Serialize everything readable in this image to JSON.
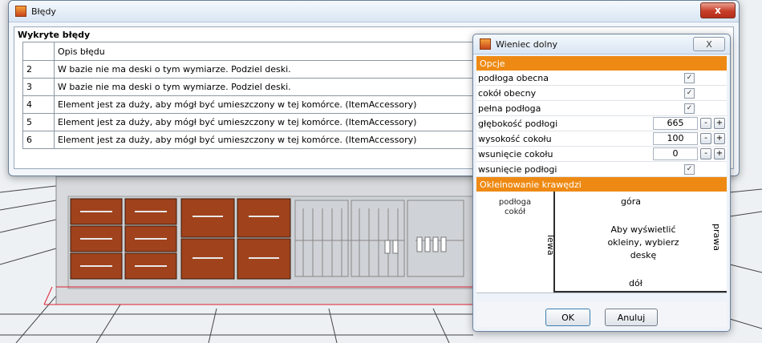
{
  "errors_window": {
    "title": "Błędy",
    "close_glyph": "x",
    "group_header": "Wykryte błędy",
    "table_header": "Opis błędu",
    "rows": [
      {
        "num": "2",
        "desc": "W bazie nie ma deski o tym wymiarze. Podziel deski."
      },
      {
        "num": "3",
        "desc": "W bazie nie ma deski o tym wymiarze. Podziel deski."
      },
      {
        "num": "4",
        "desc": "Element jest za duży, aby mógł być umieszczony w tej komórce. (ItemAccessory)"
      },
      {
        "num": "5",
        "desc": "Element jest za duży, aby mógł być umieszczony w tej komórce. (ItemAccessory)"
      },
      {
        "num": "6",
        "desc": "Element jest za duży, aby mógł być umieszczony w tej komórce. (ItemAccessory)"
      }
    ]
  },
  "wieniec_window": {
    "title": "Wieniec dolny",
    "close_glyph": "X",
    "options_header": "Opcje",
    "props": {
      "podloga_obecna": "podłoga obecna",
      "cokol_obecny": "cokół obecny",
      "pelna_podloga": "pełna podłoga",
      "glebokosc": "głębokość podłogi",
      "glebokosc_value": "665",
      "wysokosc": "wysokość cokołu",
      "wysokosc_value": "100",
      "wsuniecie_cokolu": "wsunięcie cokołu",
      "wsuniecie_cokolu_value": "0",
      "wsuniecie_podlogi": "wsunięcie podłogi",
      "check_glyph": "✓",
      "minus": "-",
      "plus": "+"
    },
    "edges_header": "Okleinowanie krawędzi",
    "edges": {
      "list_1": "podłoga",
      "list_2": "cokół",
      "top": "góra",
      "bottom": "dół",
      "left": "lewa",
      "right": "prawa",
      "hint": "Aby wyświetlić okleiny, wybierz deskę"
    },
    "ok_label": "OK",
    "cancel_label": "Anuluj"
  },
  "colors": {
    "section_orange": "#ee8a14",
    "drawer_wood": "#a0421c",
    "close_red": "#c63d28"
  }
}
